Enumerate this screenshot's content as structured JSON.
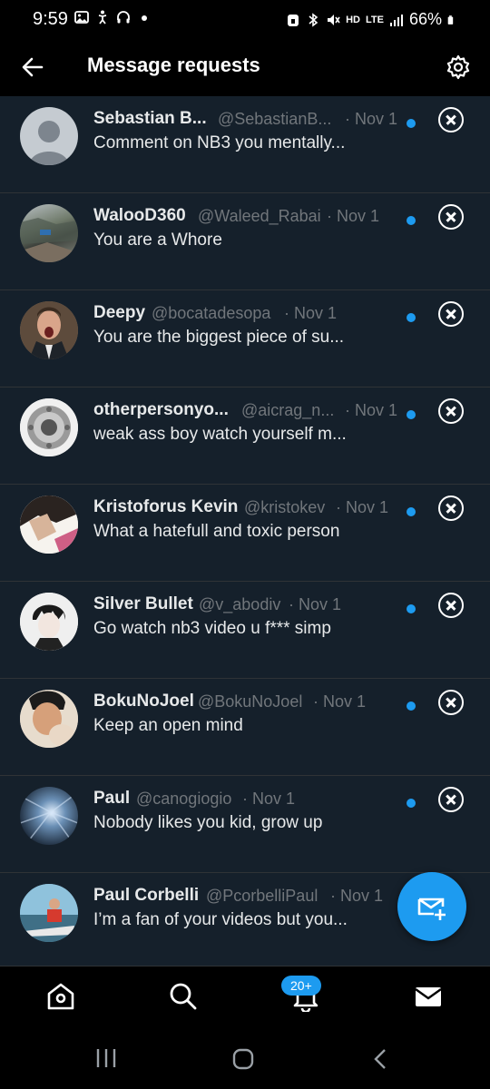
{
  "status": {
    "time": "9:59",
    "battery": "66%",
    "network": "LTE",
    "hd": "HD"
  },
  "header": {
    "title": "Message requests"
  },
  "requests": [
    {
      "name": "Sebastian B...",
      "handle": "@SebastianB...",
      "date": "· Nov 1",
      "message": "Comment on NB3 you mentally..."
    },
    {
      "name": "WalooD360",
      "handle": "@Waleed_Rabai",
      "date": "· Nov 1",
      "message": "You are a Whore"
    },
    {
      "name": "Deepy",
      "handle": "@bocatadesopa",
      "date": "· Nov 1",
      "message": "You are the biggest piece of su..."
    },
    {
      "name": "otherpersonyo...",
      "handle": "@aicrag_n...",
      "date": "· Nov 1",
      "message": "weak ass boy watch yourself m..."
    },
    {
      "name": "Kristoforus Kevin",
      "handle": "@kristokev",
      "date": "· Nov 1",
      "message": "What a hatefull and toxic person"
    },
    {
      "name": "Silver Bullet",
      "handle": "@v_abodiv",
      "date": "· Nov 1",
      "message": "Go watch nb3 video u f*** simp"
    },
    {
      "name": "BokuNoJoel",
      "handle": "@BokuNoJoel",
      "date": "· Nov 1",
      "message": "Keep an open mind"
    },
    {
      "name": "Paul",
      "handle": "@canogiogio",
      "date": "· Nov 1",
      "message": "Nobody likes you kid, grow up"
    },
    {
      "name": "Paul Corbelli",
      "handle": "@PcorbelliPaul",
      "date": "· Nov 1",
      "message": "I’m a fan of your videos but you..."
    }
  ],
  "tabbar": {
    "notifications_badge": "20+",
    "items": [
      "home-icon",
      "search-icon",
      "notifications-icon",
      "messages-icon"
    ]
  },
  "colors": {
    "accent": "#1d9bf0",
    "background": "#15202b",
    "bar": "#000000"
  }
}
